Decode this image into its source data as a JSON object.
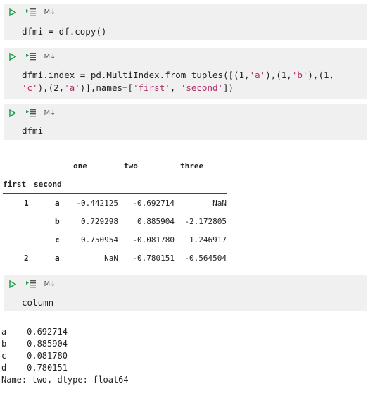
{
  "cells": [
    {
      "toolbar": {
        "md_label": "M↓"
      },
      "code": "dfmi = df.copy()"
    },
    {
      "toolbar": {
        "md_label": "M↓"
      },
      "code_parts": {
        "a": "dfmi.index = pd.MultiIndex.from_tuples([(1,",
        "s1": "'a'",
        "b": "),(1,",
        "s2": "'b'",
        "c": "),(1,",
        "s3": "'c'",
        "d": "),(2,",
        "s4": "'a'",
        "e": ")],names=[",
        "s5": "'first'",
        "f": ", ",
        "s6": "'second'",
        "g": "])"
      }
    },
    {
      "toolbar": {
        "md_label": "M↓"
      },
      "code": "dfmi"
    },
    {
      "toolbar": {
        "md_label": "M↓"
      },
      "code": "column"
    }
  ],
  "dataframe": {
    "columns": [
      "one",
      "two",
      "three"
    ],
    "index_names": [
      "first",
      "second"
    ],
    "rows": [
      {
        "first": "1",
        "second": "a",
        "one": "-0.442125",
        "two": "-0.692714",
        "three": "NaN"
      },
      {
        "first": "",
        "second": "b",
        "one": "0.729298",
        "two": "0.885904",
        "three": "-2.172805"
      },
      {
        "first": "",
        "second": "c",
        "one": "0.750954",
        "two": "-0.081780",
        "three": "1.246917"
      },
      {
        "first": "2",
        "second": "a",
        "one": "NaN",
        "two": "-0.780151",
        "three": "-0.564504"
      }
    ]
  },
  "series_output": {
    "lines": [
      "a   -0.692714",
      "b    0.885904",
      "c   -0.081780",
      "d   -0.780151",
      "Name: two, dtype: float64"
    ]
  },
  "colors": {
    "cell_bg": "#f0f0f0",
    "run_icon": "#1e9e4b",
    "string": "#b0306a"
  }
}
